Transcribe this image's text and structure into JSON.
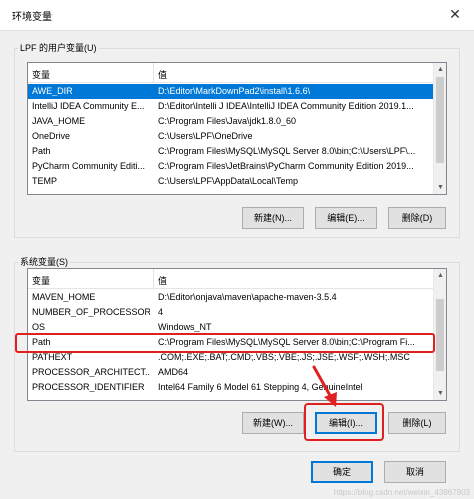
{
  "window": {
    "title": "环境变量",
    "close_label": "✕"
  },
  "user_vars": {
    "group_label": "LPF 的用户变量(U)",
    "columns": {
      "name": "变量",
      "value": "值"
    },
    "rows": [
      {
        "name": "AWE_DIR",
        "value": "D:\\Editor\\MarkDownPad2\\install\\1.6.6\\",
        "selected": true
      },
      {
        "name": "IntelliJ IDEA Community E...",
        "value": "D:\\Editor\\Intelli J IDEA\\IntelliJ IDEA Community Edition 2019.1..."
      },
      {
        "name": "JAVA_HOME",
        "value": "C:\\Program Files\\Java\\jdk1.8.0_60"
      },
      {
        "name": "OneDrive",
        "value": "C:\\Users\\LPF\\OneDrive"
      },
      {
        "name": "Path",
        "value": "C:\\Program Files\\MySQL\\MySQL Server 8.0\\bin;C:\\Users\\LPF\\..."
      },
      {
        "name": "PyCharm Community Editi...",
        "value": "C:\\Program Files\\JetBrains\\PyCharm Community Edition 2019..."
      },
      {
        "name": "TEMP",
        "value": "C:\\Users\\LPF\\AppData\\Local\\Temp"
      }
    ],
    "buttons": {
      "new": "新建(N)...",
      "edit": "编辑(E)...",
      "delete": "删除(D)"
    }
  },
  "system_vars": {
    "group_label": "系统变量(S)",
    "columns": {
      "name": "变量",
      "value": "值"
    },
    "rows": [
      {
        "name": "MAVEN_HOME",
        "value": "D:\\Editor\\onjava\\maven\\apache-maven-3.5.4"
      },
      {
        "name": "NUMBER_OF_PROCESSORS",
        "value": "4"
      },
      {
        "name": "OS",
        "value": "Windows_NT"
      },
      {
        "name": "Path",
        "value": "C:\\Program Files\\MySQL\\MySQL Server 8.0\\bin;C:\\Program Fi..."
      },
      {
        "name": "PATHEXT",
        "value": ".COM;.EXE;.BAT;.CMD;.VBS;.VBE;.JS;.JSE;.WSF;.WSH;.MSC"
      },
      {
        "name": "PROCESSOR_ARCHITECT...",
        "value": "AMD64"
      },
      {
        "name": "PROCESSOR_IDENTIFIER",
        "value": "Intel64 Family 6 Model 61 Stepping 4, GenuineIntel"
      }
    ],
    "buttons": {
      "new": "新建(W)...",
      "edit": "编辑(I)...",
      "delete": "删除(L)"
    }
  },
  "footer": {
    "ok": "确定",
    "cancel": "取消"
  },
  "watermark": "https://blog.csdn.net/weixin_43867903",
  "colors": {
    "selection": "#0078d7",
    "highlight": "#e02020"
  }
}
